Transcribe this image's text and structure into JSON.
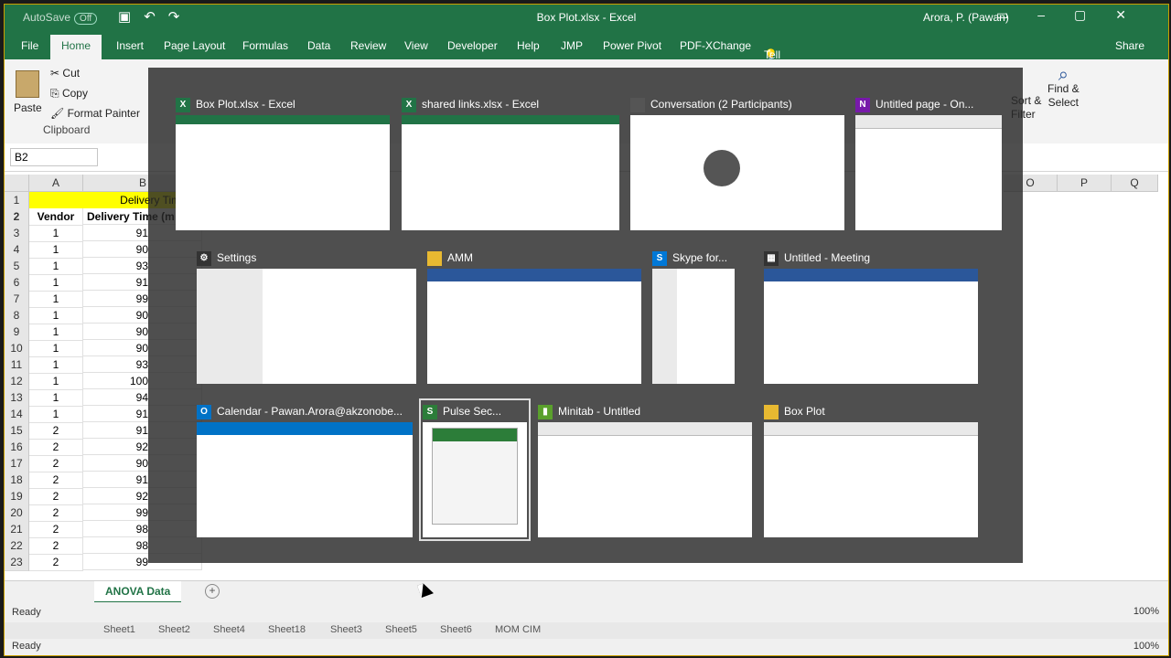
{
  "window": {
    "title": "Box Plot.xlsx  -  Excel",
    "user": "Arora, P. (Pawan)",
    "autosave_label": "AutoSave",
    "autosave_state": "Off"
  },
  "ribbon_tabs": [
    "File",
    "Home",
    "Insert",
    "Page Layout",
    "Formulas",
    "Data",
    "Review",
    "View",
    "Developer",
    "Help",
    "JMP",
    "Power Pivot",
    "PDF-XChange"
  ],
  "tell_me": "Tell me what you want to do",
  "share": "Share",
  "clipboard": {
    "paste": "Paste",
    "cut": "Cut",
    "copy": "Copy",
    "format_painter": "Format Painter",
    "group": "Clipboard"
  },
  "editing": {
    "find_select": "Find &\nSelect",
    "sort_filter": "Sort &\nFilter"
  },
  "formula_bar": {
    "name_box": "B2"
  },
  "columns": [
    "A",
    "B"
  ],
  "right_columns": [
    "O",
    "P",
    "Q"
  ],
  "sheet": {
    "title": "Delivery Time",
    "header_a": "Vendor",
    "header_b": "Delivery Time (m",
    "rows": [
      {
        "n": "3",
        "a": "1",
        "b": "91"
      },
      {
        "n": "4",
        "a": "1",
        "b": "90"
      },
      {
        "n": "5",
        "a": "1",
        "b": "93"
      },
      {
        "n": "6",
        "a": "1",
        "b": "91"
      },
      {
        "n": "7",
        "a": "1",
        "b": "99"
      },
      {
        "n": "8",
        "a": "1",
        "b": "90"
      },
      {
        "n": "9",
        "a": "1",
        "b": "90"
      },
      {
        "n": "10",
        "a": "1",
        "b": "90"
      },
      {
        "n": "11",
        "a": "1",
        "b": "93"
      },
      {
        "n": "12",
        "a": "1",
        "b": "100"
      },
      {
        "n": "13",
        "a": "1",
        "b": "94"
      },
      {
        "n": "14",
        "a": "1",
        "b": "91"
      },
      {
        "n": "15",
        "a": "2",
        "b": "91"
      },
      {
        "n": "16",
        "a": "2",
        "b": "92"
      },
      {
        "n": "17",
        "a": "2",
        "b": "90"
      },
      {
        "n": "18",
        "a": "2",
        "b": "91"
      },
      {
        "n": "19",
        "a": "2",
        "b": "92"
      },
      {
        "n": "20",
        "a": "2",
        "b": "99"
      },
      {
        "n": "21",
        "a": "2",
        "b": "98"
      },
      {
        "n": "22",
        "a": "2",
        "b": "98"
      },
      {
        "n": "23",
        "a": "2",
        "b": "99"
      }
    ]
  },
  "sheet_tabs": {
    "active": "ANOVA Data",
    "add": "+"
  },
  "status": {
    "ready": "Ready",
    "zoom": "100%"
  },
  "ghost_tabs": [
    "Sheet1",
    "Sheet2",
    "Sheet4",
    "Sheet18",
    "Sheet3",
    "Sheet5",
    "Sheet6",
    "MOM CIM"
  ],
  "switcher": {
    "windows": [
      {
        "title": "Box Plot.xlsx - Excel",
        "icon": "X",
        "color": "#217346"
      },
      {
        "title": "shared links.xlsx - Excel",
        "icon": "X",
        "color": "#217346"
      },
      {
        "title": "Conversation (2 Participants)",
        "icon": "",
        "color": "#555555"
      },
      {
        "title": "Untitled page - On...",
        "icon": "N",
        "color": "#7719aa"
      },
      {
        "title": "Settings",
        "icon": "⚙",
        "color": "#333333"
      },
      {
        "title": "AMM",
        "icon": "",
        "color": "#e8b931"
      },
      {
        "title": "Skype for...",
        "icon": "S",
        "color": "#0078d7"
      },
      {
        "title": "Untitled - Meeting",
        "icon": "▦",
        "color": "#333333"
      },
      {
        "title": "Calendar - Pawan.Arora@akzonobe...",
        "icon": "O",
        "color": "#0072c6"
      },
      {
        "title": "Pulse Sec...",
        "icon": "S",
        "color": "#2c7d39"
      },
      {
        "title": "Minitab - Untitled",
        "icon": "▮",
        "color": "#5aa02c"
      },
      {
        "title": "Box Plot",
        "icon": "",
        "color": "#e8b931"
      }
    ]
  }
}
